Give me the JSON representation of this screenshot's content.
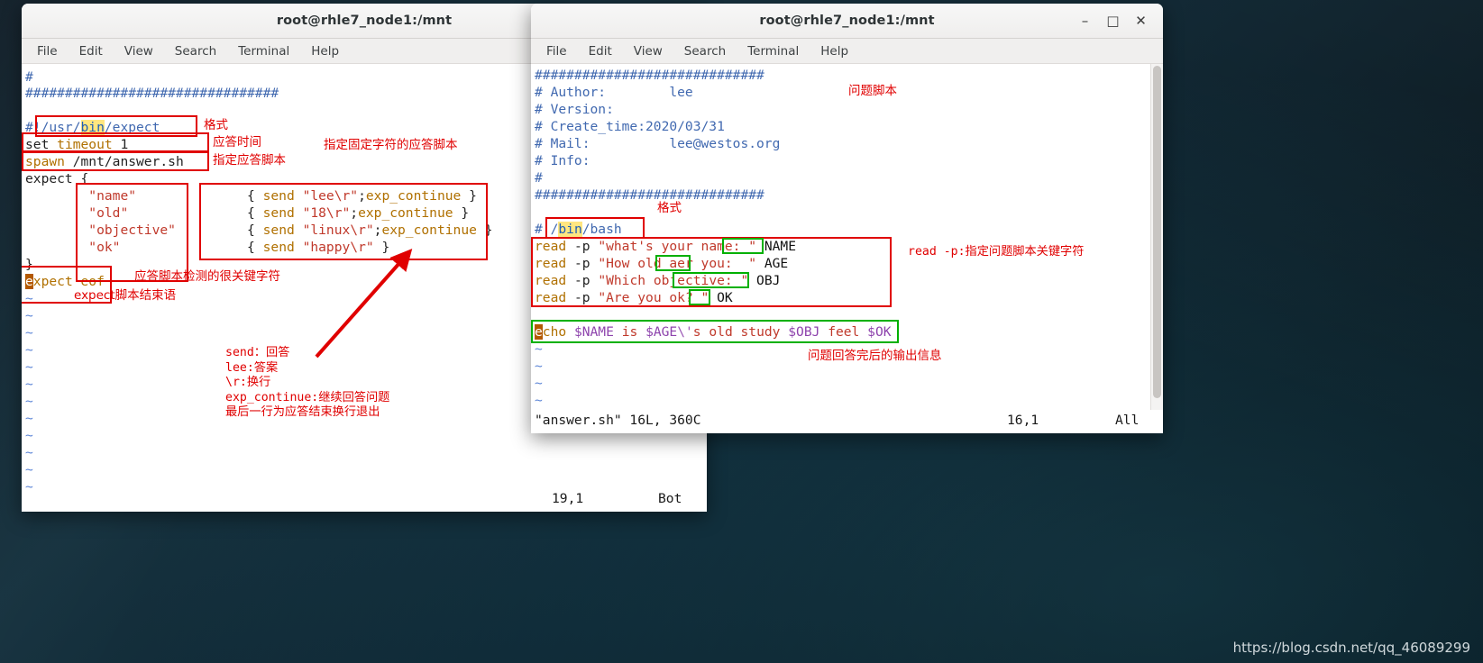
{
  "desktop": {
    "watermark": "https://blog.csdn.net/qq_46089299",
    "background_color": "#0e2630"
  },
  "windows": [
    {
      "id": "expect-window",
      "title": "root@rhle7_node1:/mnt",
      "menus": [
        "File",
        "Edit",
        "View",
        "Search",
        "Terminal",
        "Help"
      ],
      "controls": {
        "minimize": "–",
        "maximize": "□",
        "close": "✕"
      },
      "editor_lines": [
        "#",
        "################################",
        "",
        "#!/usr/bin/expect",
        "set timeout 1",
        "spawn /mnt/answer.sh",
        "expect {",
        "        \"name\"             { send \"lee\\r\";exp_continue }",
        "        \"old\"              { send \"18\\r\";exp_continue }",
        "        \"objective\"        { send \"linux\\r\";exp_continue }",
        "        \"ok\"               { send \"happy\\r\" }",
        "}",
        "expect eof"
      ],
      "tilde_count": 14,
      "status": {
        "position": "19,1",
        "scroll": "Bot"
      },
      "annotations": [
        {
          "id": "fixed-chars",
          "text": "指定固定字符的应答脚本"
        },
        {
          "id": "format",
          "text": "格式"
        },
        {
          "id": "answer-time",
          "text": "应答时间"
        },
        {
          "id": "specify-script",
          "text": "指定应答脚本"
        },
        {
          "id": "keywords",
          "text": "应答脚本检测的很关键字符"
        },
        {
          "id": "expect-end",
          "text": "expect脚本结束语"
        },
        {
          "id": "send-explain",
          "text": "send：回答\nlee:答案\n\\r:换行\nexp_continue:继续回答问题\n最后一行为应答结束换行退出"
        }
      ]
    },
    {
      "id": "answer-window",
      "title": "root@rhle7_node1:/mnt",
      "menus": [
        "File",
        "Edit",
        "View",
        "Search",
        "Terminal",
        "Help"
      ],
      "controls": {
        "minimize": "–",
        "maximize": "□",
        "close": "✕"
      },
      "editor_lines": [
        "#############################",
        "# Author:        lee",
        "# Version:",
        "# Create_time:2020/03/31",
        "# Mail:          lee@westos.org",
        "# Info:",
        "#",
        "#############################",
        "",
        "# /bin/bash",
        "read -p \"what's your name: \" NAME",
        "read -p \"How old aer you:  \" AGE",
        "read -p \"Which objective: \" OBJ",
        "read -p \"Are you ok? \" OK",
        "",
        "echo $NAME is $AGE\\'s old study $OBJ feel $OK"
      ],
      "tilde_count": 8,
      "status": {
        "file": "\"answer.sh\" 16L, 360C",
        "position": "16,1",
        "scroll": "All"
      },
      "annotations": [
        {
          "id": "question-script",
          "text": "问题脚本"
        },
        {
          "id": "format",
          "text": "格式"
        },
        {
          "id": "read-p-explain",
          "text": "read -p:指定问题脚本关键字符"
        },
        {
          "id": "output-info",
          "text": "问题回答完后的输出信息"
        }
      ]
    }
  ]
}
